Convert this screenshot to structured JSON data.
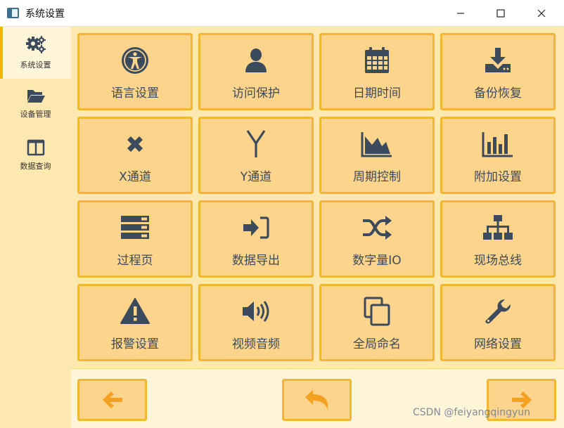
{
  "window": {
    "title": "系统设置",
    "icons": {
      "minimize": "minimize-icon",
      "maximize": "maximize-icon",
      "close": "close-icon"
    }
  },
  "sidebar": {
    "items": [
      {
        "label": "系统设置",
        "icon": "gears-icon",
        "active": true
      },
      {
        "label": "设备管理",
        "icon": "folder-open-icon",
        "active": false
      },
      {
        "label": "数据查询",
        "icon": "columns-icon",
        "active": false
      }
    ]
  },
  "tiles": [
    {
      "label": "语言设置",
      "icon": "universal-access-icon"
    },
    {
      "label": "访问保护",
      "icon": "user-icon"
    },
    {
      "label": "日期时间",
      "icon": "calendar-icon"
    },
    {
      "label": "备份恢复",
      "icon": "download-icon"
    },
    {
      "label": "X通道",
      "icon": "x-icon"
    },
    {
      "label": "Y通道",
      "icon": "y-icon"
    },
    {
      "label": "周期控制",
      "icon": "area-chart-icon"
    },
    {
      "label": "附加设置",
      "icon": "bar-chart-icon"
    },
    {
      "label": "过程页",
      "icon": "server-icon"
    },
    {
      "label": "数据导出",
      "icon": "sign-in-icon"
    },
    {
      "label": "数字量IO",
      "icon": "random-icon"
    },
    {
      "label": "现场总线",
      "icon": "sitemap-icon"
    },
    {
      "label": "报警设置",
      "icon": "warning-icon"
    },
    {
      "label": "视频音频",
      "icon": "volume-icon"
    },
    {
      "label": "全局命名",
      "icon": "copy-icon"
    },
    {
      "label": "网络设置",
      "icon": "wrench-icon"
    }
  ],
  "bottom_nav": {
    "prev_icon": "arrow-left-icon",
    "back_icon": "undo-icon",
    "next_icon": "arrow-right-icon"
  },
  "watermark": "CSDN @feiyangqingyun",
  "colors": {
    "accent": "#f4b400",
    "tile_bg": "#fcd48c",
    "tile_border": "#f2b632",
    "icon": "#3b4a5c",
    "nav_icon": "#f4a020"
  }
}
